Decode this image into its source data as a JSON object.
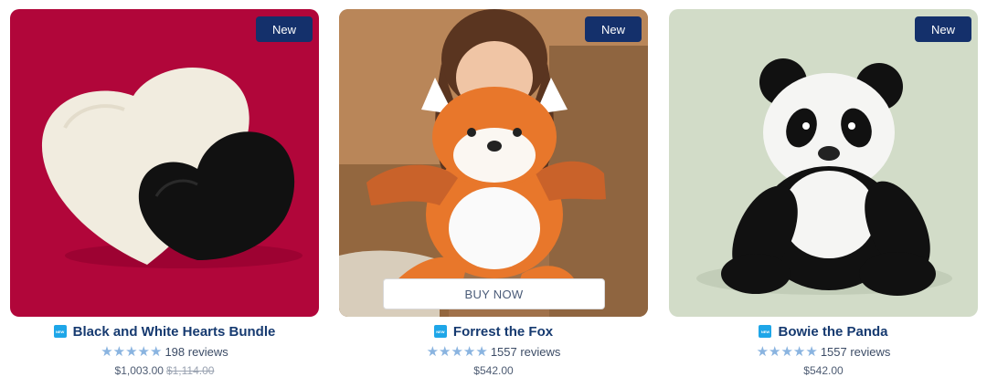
{
  "products": [
    {
      "badge": "New",
      "title": "Black and White Hearts Bundle",
      "title_icon": "new-icon",
      "icon_text": "NEW",
      "stars": "★★★★★",
      "reviews": "198 reviews",
      "price": "$1,003.00",
      "original_price": "$1,114.00",
      "image_bg": "#b1063a"
    },
    {
      "badge": "New",
      "title": "Forrest the Fox",
      "title_icon": "new-icon",
      "icon_text": "NEW",
      "stars": "★★★★★",
      "reviews": "1557 reviews",
      "price": "$542.00",
      "buy_label": "BUY NOW",
      "image_bg": "#a0714a"
    },
    {
      "badge": "New",
      "title": "Bowie the Panda",
      "title_icon": "new-icon",
      "icon_text": "NEW",
      "stars": "★★★★★",
      "reviews": "1557 reviews",
      "price": "$542.00",
      "image_bg": "#d2dcc8"
    }
  ],
  "colors": {
    "badge": "#14306b",
    "title": "#163a70",
    "star": "#8ab4e0",
    "new_icon": "#1ea6e8"
  }
}
